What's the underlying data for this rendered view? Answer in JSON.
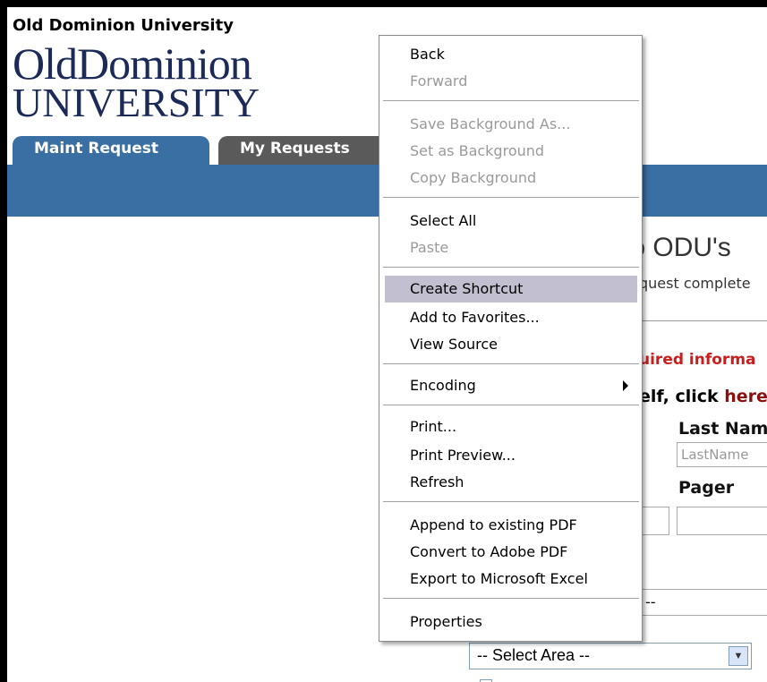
{
  "header": {
    "university_text": "Old Dominion University",
    "logo_line1": "OldDominion",
    "logo_line2": "UNIVERSITY"
  },
  "tabs": [
    {
      "label": "Maint Request",
      "active": true
    },
    {
      "label": "My Requests",
      "active": false
    }
  ],
  "page": {
    "welcome_partial": "to ODU's",
    "request_partial": "quest complete",
    "required_partial": "uired informa",
    "self_click_partial": "elf, click ",
    "self_click_link": "here",
    "lastname_label": "Last Nam",
    "lastname_placeholder": "LastName",
    "pager_label": "Pager",
    "select_partial": "--",
    "select_area_value": "-- Select Area --"
  },
  "context_menu": {
    "items": [
      {
        "label": "Back",
        "enabled": true
      },
      {
        "label": "Forward",
        "enabled": false
      },
      {
        "label": "Save Background As...",
        "enabled": false
      },
      {
        "label": "Set as Background",
        "enabled": false
      },
      {
        "label": "Copy Background",
        "enabled": false
      },
      {
        "label": "Select All",
        "enabled": true
      },
      {
        "label": "Paste",
        "enabled": false
      },
      {
        "label": "Create Shortcut",
        "enabled": true,
        "highlighted": true
      },
      {
        "label": "Add to Favorites...",
        "enabled": true
      },
      {
        "label": "View Source",
        "enabled": true
      },
      {
        "label": "Encoding",
        "enabled": true,
        "submenu": true
      },
      {
        "label": "Print...",
        "enabled": true
      },
      {
        "label": "Print Preview...",
        "enabled": true
      },
      {
        "label": "Refresh",
        "enabled": true
      },
      {
        "label": "Append to existing PDF",
        "enabled": true
      },
      {
        "label": "Convert to Adobe PDF",
        "enabled": true
      },
      {
        "label": "Export to Microsoft Excel",
        "enabled": true
      },
      {
        "label": "Properties",
        "enabled": true
      }
    ]
  },
  "colors": {
    "brand_blue": "#3a6fa3",
    "menu_highlight": "#c1bfd0",
    "required_red": "#c81e1e"
  }
}
